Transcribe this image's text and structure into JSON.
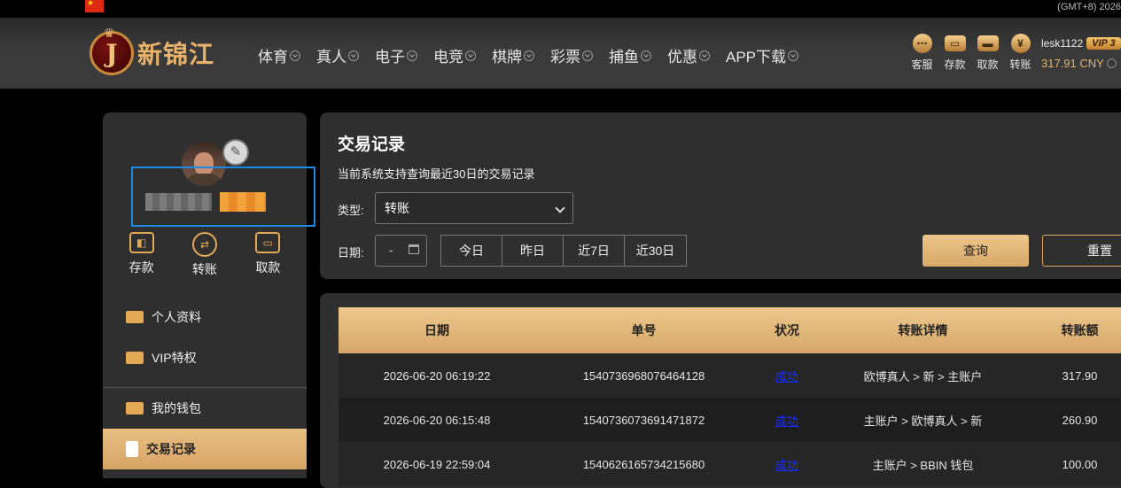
{
  "topbar": {
    "timezone": "(GMT+8) 2026"
  },
  "brand": {
    "logo_letter": "J",
    "name": "新锦江"
  },
  "nav": [
    "体育",
    "真人",
    "电子",
    "电竞",
    "棋牌",
    "彩票",
    "捕鱼",
    "优惠",
    "APP下载"
  ],
  "quick": [
    {
      "label": "客服",
      "icon": "chat-icon"
    },
    {
      "label": "存款",
      "icon": "wallet-icon"
    },
    {
      "label": "取款",
      "icon": "withdraw-icon"
    },
    {
      "label": "转账",
      "icon": "transfer-icon"
    }
  ],
  "user": {
    "name": "lesk1122",
    "vip": "VIP 3",
    "balance": "317.91 CNY"
  },
  "sidebar": {
    "actions": [
      {
        "label": "存款",
        "icon": "wallet-icon"
      },
      {
        "label": "转账",
        "icon": "transfer-icon"
      },
      {
        "label": "取款",
        "icon": "card-icon"
      }
    ],
    "menu": [
      "个人资料",
      "VIP特权",
      "我的钱包",
      "交易记录"
    ]
  },
  "panel": {
    "title": "交易记录",
    "subtitle": "当前系统支持查询最近30日的交易记录",
    "type_label": "类型:",
    "type_value": "转账",
    "date_label": "日期:",
    "date_value": "-",
    "quick_ranges": [
      "今日",
      "昨日",
      "近7日",
      "近30日"
    ],
    "search_label": "查询",
    "reset_label": "重置"
  },
  "table": {
    "headers": [
      "日期",
      "单号",
      "状况",
      "转账详情",
      "转账额"
    ],
    "rows": [
      [
        "2026-06-20 06:19:22",
        "1540736968076464128",
        "成功",
        "欧博真人 > 新 > 主账户",
        "317.90"
      ],
      [
        "2026-06-20 06:15:48",
        "1540736073691471872",
        "成功",
        "主账户 > 欧博真人 > 新",
        "260.90"
      ],
      [
        "2026-06-19 22:59:04",
        "1540626165734215680",
        "成功",
        "主账户 > BBIN 钱包",
        "100.00"
      ]
    ]
  },
  "colors": {
    "accent": "#e3a954",
    "success_link": "#1a2fff",
    "highlight_box": "#1e88e5"
  }
}
